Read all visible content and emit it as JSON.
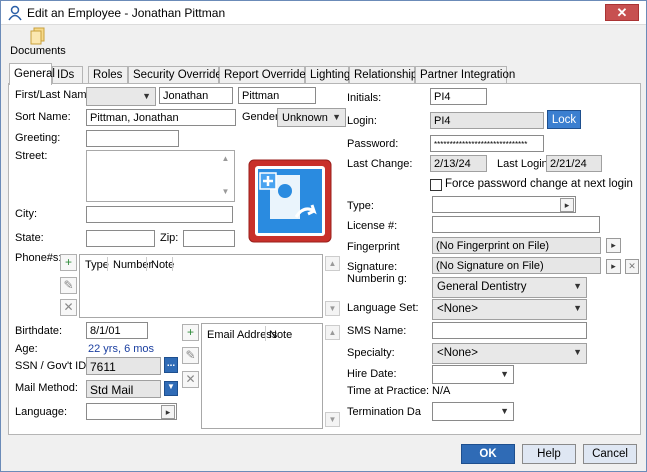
{
  "window": {
    "title": "Edit an Employee - Jonathan Pittman",
    "close_label": "✕"
  },
  "toolbar": {
    "documents_label": "Documents"
  },
  "tabs": [
    {
      "label": "General"
    },
    {
      "label": "IDs"
    },
    {
      "label": "Roles"
    },
    {
      "label": "Security Overrides"
    },
    {
      "label": "Report Overrides"
    },
    {
      "label": "Lighting"
    },
    {
      "label": "Relationships"
    },
    {
      "label": "Partner Integration"
    }
  ],
  "form": {
    "first_last_label": "First/Last Name:",
    "first_name": "Jonathan",
    "last_name": "Pittman",
    "sort_name_label": "Sort Name:",
    "sort_name": "Pittman, Jonathan",
    "gender_label": "Gender:",
    "gender": "Unknown",
    "greeting_label": "Greeting:",
    "street_label": "Street:",
    "city_label": "City:",
    "state_label": "State:",
    "zip_label": "Zip:",
    "phone_label": "Phone#s:",
    "phone_columns": [
      "Type",
      "Number",
      "Note"
    ],
    "birthdate_label": "Birthdate:",
    "birthdate": "8/1/01",
    "age_label": "Age:",
    "age": "22 yrs, 6 mos",
    "ssn_label": "SSN / Gov't ID #:",
    "ssn": "7611",
    "ssn_more": "...",
    "mail_method_label": "Mail Method:",
    "mail_method": "Std Mail",
    "language_label": "Language:",
    "email_columns": [
      "Email Address",
      "Note"
    ],
    "initials_label": "Initials:",
    "initials": "PI4",
    "login_label": "Login:",
    "login": "PI4",
    "lock_label": "Lock",
    "password_label": "Password:",
    "password": "******************************",
    "last_change_label": "Last Change:",
    "last_change": "2/13/24",
    "last_login_label": "Last Login:",
    "last_login": "2/21/24",
    "force_pw_label": "Force password change at next login",
    "type_label": "Type:",
    "license_label": "License #:",
    "fingerprint_label": "Fingerprint",
    "fingerprint_value": "(No Fingerprint on File)",
    "signature_label": "Signature:",
    "signature_value": "(No Signature on File)",
    "numbering_label": "Numberin g:",
    "numbering": "General Dentistry",
    "language_set_label": "Language Set:",
    "language_set": "<None>",
    "sms_label": "SMS Name:",
    "specialty_label": "Specialty:",
    "specialty": "<None>",
    "hire_date_label": "Hire Date:",
    "time_at_practice_label": "Time at Practice:",
    "time_at_practice": "N/A",
    "termination_label": "Termination Da"
  },
  "footer": {
    "ok": "OK",
    "help": "Help",
    "cancel": "Cancel"
  }
}
